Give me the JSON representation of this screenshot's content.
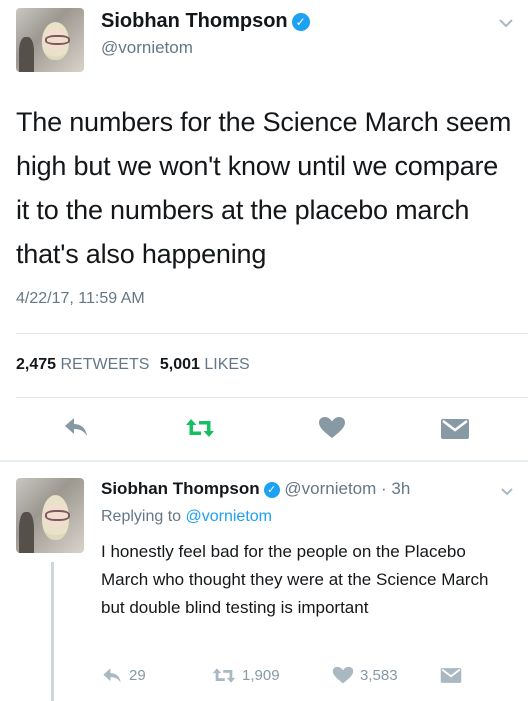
{
  "tweet": {
    "author_name": "Siobhan Thompson",
    "handle": "@vornietom",
    "text": "The numbers for the Science March seem high but we won't know until we compare it to the numbers at the placebo march that's also happening",
    "timestamp": "4/22/17, 11:59 AM",
    "retweets_count": "2,475",
    "retweets_label": "RETWEETS",
    "likes_count": "5,001",
    "likes_label": "LIKES",
    "icons": [
      "reply-icon",
      "retweet-icon",
      "like-icon",
      "dm-icon",
      "chevron-down-icon",
      "verified-icon"
    ]
  },
  "reply": {
    "author_name": "Siobhan Thompson",
    "handle": "@vornietom",
    "time": "· 3h",
    "replying_prefix": "Replying to",
    "replying_handle": "@vornietom",
    "text": "I honestly feel bad for the people on the Placebo March who thought they were at the Science March but double blind testing is important",
    "reply_count": "29",
    "retweet_count": "1,909",
    "like_count": "3,583"
  },
  "colors": {
    "accent": "#1da1f2",
    "retweet_green": "#17bf63",
    "text": "#14171a",
    "muted": "#657786"
  }
}
